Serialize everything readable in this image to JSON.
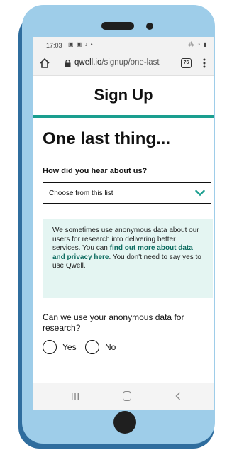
{
  "status_bar": {
    "time": "17:03",
    "left_icons": "▣ ▣ ♪ •",
    "right_icons": "⁂ ◔ ▮"
  },
  "browser": {
    "url_domain": "qwell.io",
    "url_path": "/signup/one-last",
    "tab_count": "76"
  },
  "header": {
    "title": "Sign Up",
    "accent_color": "#1a9e8f"
  },
  "form": {
    "heading": "One last thing...",
    "source_question": "How did you hear about us?",
    "source_select_value": "Choose from this list",
    "info": {
      "text_before_link": "We sometimes use anonymous data about our users for research into delivering better services. You can ",
      "link_text": "find out more about data and privacy here",
      "text_after_link": ". You don't need to say yes to use Qwell."
    },
    "research_question": "Can we use your anonymous data for research?",
    "options": [
      "Yes",
      "No"
    ]
  },
  "icons": {
    "home": "home-icon",
    "lock": "lock-icon",
    "menu": "more-vert-icon",
    "chevron": "chevron-down-icon"
  }
}
